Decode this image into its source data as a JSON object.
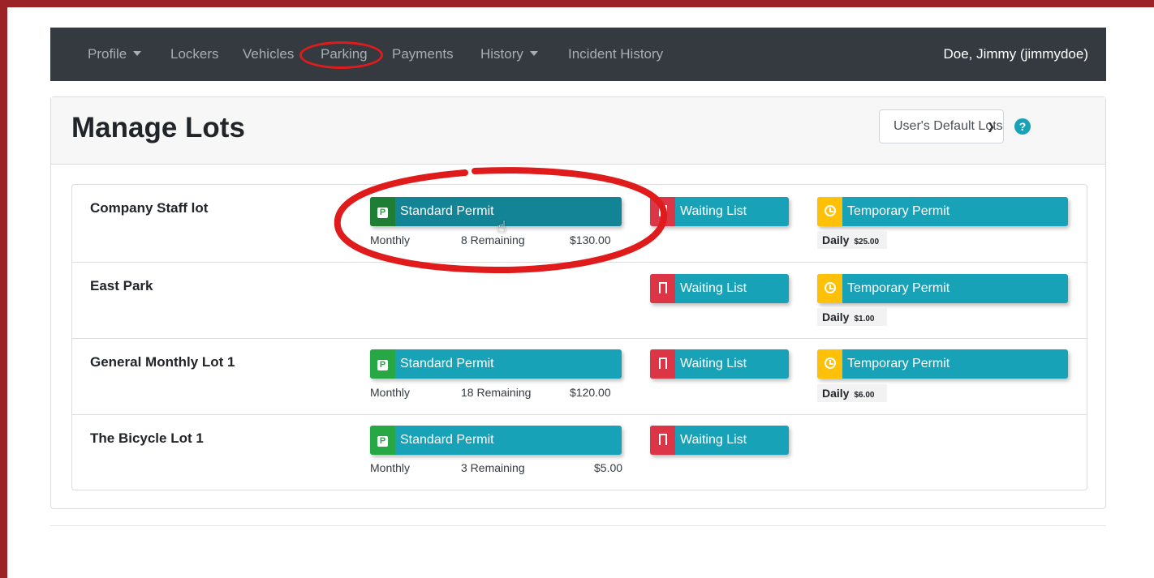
{
  "nav": {
    "items": [
      {
        "label": "Profile",
        "dropdown": true
      },
      {
        "label": "Lockers"
      },
      {
        "label": "Vehicles"
      },
      {
        "label": "Parking",
        "highlighted": true
      },
      {
        "label": "Payments"
      },
      {
        "label": "History",
        "dropdown": true
      },
      {
        "label": "Incident History"
      }
    ],
    "user": "Doe, Jimmy (jimmydoe)"
  },
  "page": {
    "title": "Manage Lots",
    "lot_filter": "User's Default Lots",
    "help_icon": "question-circle-icon"
  },
  "lots": [
    {
      "name": "Company Staff lot",
      "standard": {
        "label": "Standard Permit",
        "period": "Monthly",
        "remaining": "8 Remaining",
        "price": "$130.00"
      },
      "waiting": {
        "label": "Waiting List"
      },
      "temporary": {
        "label": "Temporary Permit",
        "period": "Daily",
        "price": "$25.00"
      }
    },
    {
      "name": "East Park",
      "waiting": {
        "label": "Waiting List"
      },
      "temporary": {
        "label": "Temporary Permit",
        "period": "Daily",
        "price": "$1.00"
      }
    },
    {
      "name": "General Monthly Lot 1",
      "standard": {
        "label": "Standard Permit",
        "period": "Monthly",
        "remaining": "18 Remaining",
        "price": "$120.00"
      },
      "waiting": {
        "label": "Waiting List"
      },
      "temporary": {
        "label": "Temporary Permit",
        "period": "Daily",
        "price": "$6.00"
      }
    },
    {
      "name": "The Bicycle Lot 1",
      "standard": {
        "label": "Standard Permit",
        "period": "Monthly",
        "remaining": "3 Remaining",
        "price": "$5.00"
      },
      "waiting": {
        "label": "Waiting List"
      }
    }
  ],
  "colors": {
    "navbar": "#343a40",
    "button": "#17a2b8",
    "button_active": "#138496",
    "permit_icon": "#28a745",
    "waiting_icon": "#dc3545",
    "temporary_icon": "#ffc107",
    "annotation_red": "#e01b1b"
  }
}
